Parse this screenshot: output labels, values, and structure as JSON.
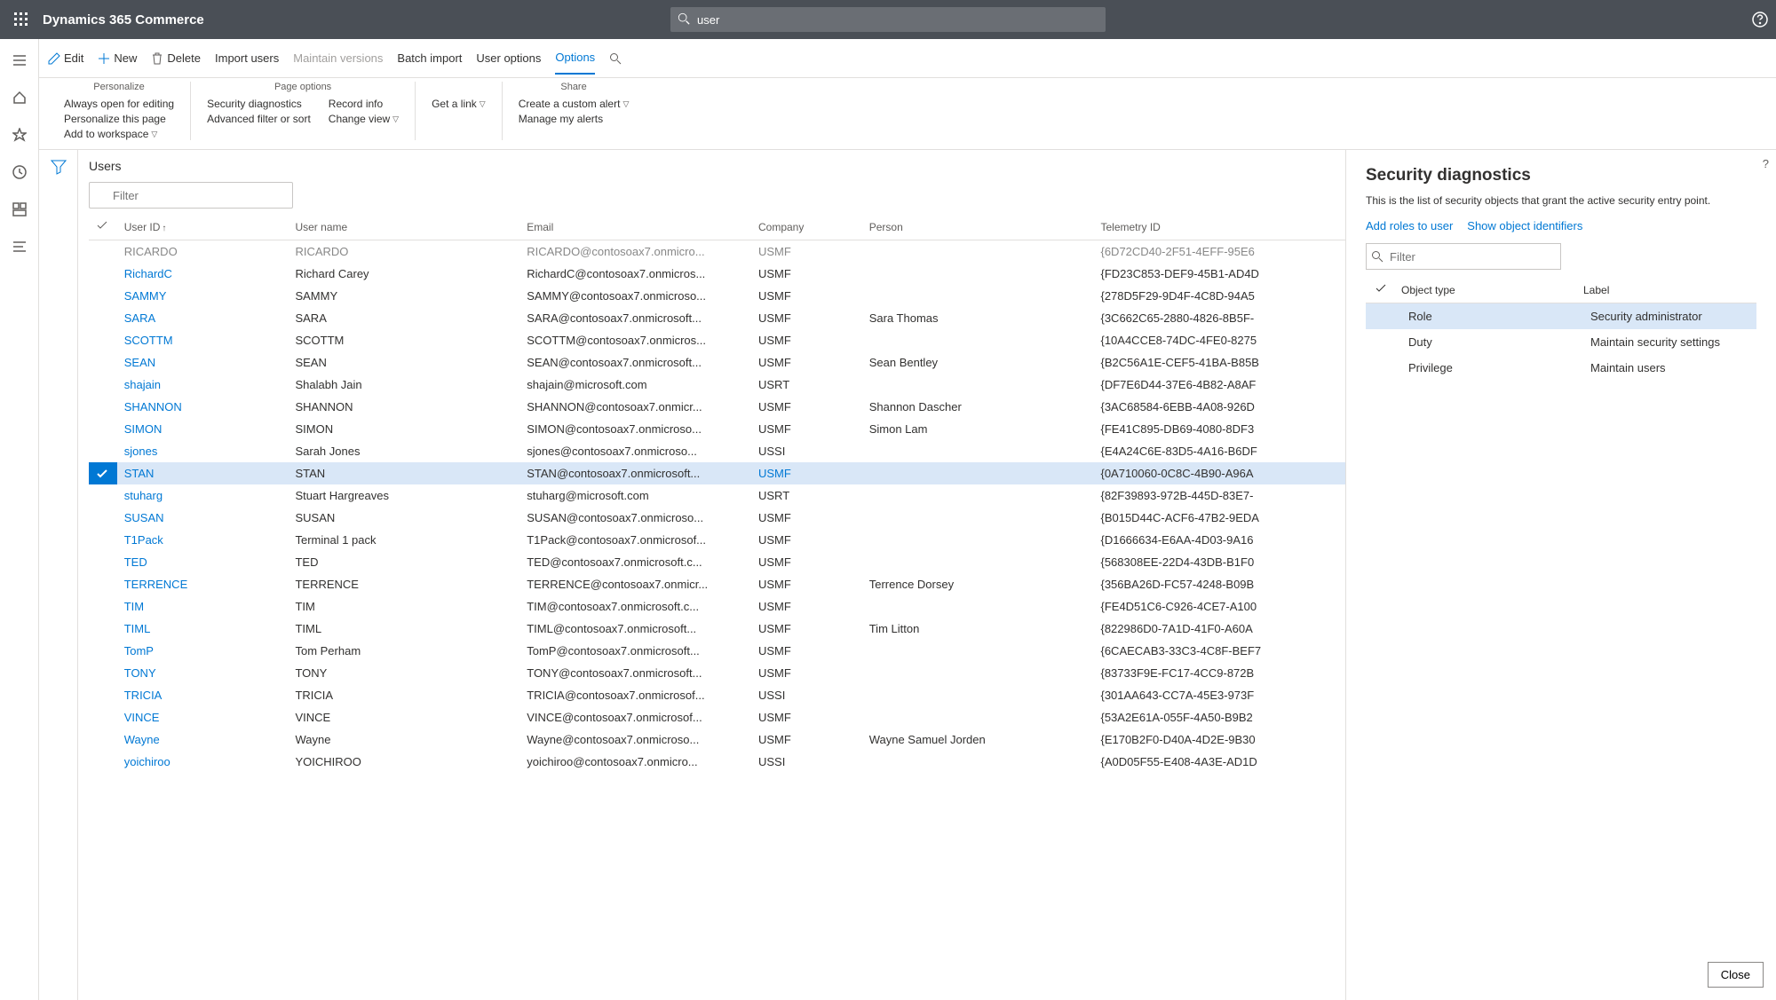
{
  "app": {
    "title": "Dynamics 365 Commerce"
  },
  "search": {
    "value": "user"
  },
  "actions": {
    "edit": "Edit",
    "new": "New",
    "delete": "Delete",
    "import": "Import users",
    "maintain": "Maintain versions",
    "batch": "Batch import",
    "useropt": "User options",
    "options": "Options"
  },
  "ribbon": {
    "personalize": {
      "title": "Personalize",
      "always_open": "Always open for editing",
      "personalize_page": "Personalize this page",
      "add_workspace": "Add to workspace"
    },
    "page_options": {
      "title": "Page options",
      "sec_diag": "Security diagnostics",
      "adv_filter": "Advanced filter or sort",
      "record_info": "Record info",
      "change_view": "Change view"
    },
    "getlink": "Get a link",
    "share": {
      "title": "Share",
      "create_alert": "Create a custom alert",
      "manage_alerts": "Manage my alerts"
    }
  },
  "grid": {
    "title": "Users",
    "filter_placeholder": "Filter",
    "columns": {
      "userid": "User ID",
      "username": "User name",
      "email": "Email",
      "company": "Company",
      "person": "Person",
      "telemetry": "Telemetry ID"
    },
    "rows": [
      {
        "cutoff": true,
        "uid": "RICARDO",
        "uname": "RICARDO",
        "email": "RICARDO@contosoax7.onmicro...",
        "comp": "USMF",
        "person": "",
        "tel": "{6D72CD40-2F51-4EFF-95E6"
      },
      {
        "uid": "RichardC",
        "uname": "Richard Carey",
        "email": "RichardC@contosoax7.onmicros...",
        "comp": "USMF",
        "person": "",
        "tel": "{FD23C853-DEF9-45B1-AD4D"
      },
      {
        "uid": "SAMMY",
        "uname": "SAMMY",
        "email": "SAMMY@contosoax7.onmicroso...",
        "comp": "USMF",
        "person": "",
        "tel": "{278D5F29-9D4F-4C8D-94A5"
      },
      {
        "uid": "SARA",
        "uname": "SARA",
        "email": "SARA@contosoax7.onmicrosoft...",
        "comp": "USMF",
        "person": "Sara Thomas",
        "tel": "{3C662C65-2880-4826-8B5F-"
      },
      {
        "uid": "SCOTTM",
        "uname": "SCOTTM",
        "email": "SCOTTM@contosoax7.onmicros...",
        "comp": "USMF",
        "person": "",
        "tel": "{10A4CCE8-74DC-4FE0-8275"
      },
      {
        "uid": "SEAN",
        "uname": "SEAN",
        "email": "SEAN@contosoax7.onmicrosoft...",
        "comp": "USMF",
        "person": "Sean Bentley",
        "tel": "{B2C56A1E-CEF5-41BA-B85B"
      },
      {
        "uid": "shajain",
        "uname": "Shalabh Jain",
        "email": "shajain@microsoft.com",
        "comp": "USRT",
        "person": "",
        "tel": "{DF7E6D44-37E6-4B82-A8AF"
      },
      {
        "uid": "SHANNON",
        "uname": "SHANNON",
        "email": "SHANNON@contosoax7.onmicr...",
        "comp": "USMF",
        "person": "Shannon Dascher",
        "tel": "{3AC68584-6EBB-4A08-926D"
      },
      {
        "uid": "SIMON",
        "uname": "SIMON",
        "email": "SIMON@contosoax7.onmicroso...",
        "comp": "USMF",
        "person": "Simon Lam",
        "tel": "{FE41C895-DB69-4080-8DF3"
      },
      {
        "uid": "sjones",
        "uname": "Sarah Jones",
        "email": "sjones@contosoax7.onmicroso...",
        "comp": "USSI",
        "person": "",
        "tel": "{E4A24C6E-83D5-4A16-B6DF"
      },
      {
        "selected": true,
        "uid": "STAN",
        "uname": "STAN",
        "email": "STAN@contosoax7.onmicrosoft...",
        "comp": "USMF",
        "person": "",
        "tel": "{0A710060-0C8C-4B90-A96A"
      },
      {
        "uid": "stuharg",
        "uname": "Stuart Hargreaves",
        "email": "stuharg@microsoft.com",
        "comp": "USRT",
        "person": "",
        "tel": "{82F39893-972B-445D-83E7-"
      },
      {
        "uid": "SUSAN",
        "uname": "SUSAN",
        "email": "SUSAN@contosoax7.onmicroso...",
        "comp": "USMF",
        "person": "",
        "tel": "{B015D44C-ACF6-47B2-9EDA"
      },
      {
        "uid": "T1Pack",
        "uname": "Terminal 1 pack",
        "email": "T1Pack@contosoax7.onmicrosof...",
        "comp": "USMF",
        "person": "",
        "tel": "{D1666634-E6AA-4D03-9A16"
      },
      {
        "uid": "TED",
        "uname": "TED",
        "email": "TED@contosoax7.onmicrosoft.c...",
        "comp": "USMF",
        "person": "",
        "tel": "{568308EE-22D4-43DB-B1F0"
      },
      {
        "uid": "TERRENCE",
        "uname": "TERRENCE",
        "email": "TERRENCE@contosoax7.onmicr...",
        "comp": "USMF",
        "person": "Terrence Dorsey",
        "tel": "{356BA26D-FC57-4248-B09B"
      },
      {
        "uid": "TIM",
        "uname": "TIM",
        "email": "TIM@contosoax7.onmicrosoft.c...",
        "comp": "USMF",
        "person": "",
        "tel": "{FE4D51C6-C926-4CE7-A100"
      },
      {
        "uid": "TIML",
        "uname": "TIML",
        "email": "TIML@contosoax7.onmicrosoft...",
        "comp": "USMF",
        "person": "Tim Litton",
        "tel": "{822986D0-7A1D-41F0-A60A"
      },
      {
        "uid": "TomP",
        "uname": "Tom Perham",
        "email": "TomP@contosoax7.onmicrosoft...",
        "comp": "USMF",
        "person": "",
        "tel": "{6CAECAB3-33C3-4C8F-BEF7"
      },
      {
        "uid": "TONY",
        "uname": "TONY",
        "email": "TONY@contosoax7.onmicrosoft...",
        "comp": "USMF",
        "person": "",
        "tel": "{83733F9E-FC17-4CC9-872B"
      },
      {
        "uid": "TRICIA",
        "uname": "TRICIA",
        "email": "TRICIA@contosoax7.onmicrosof...",
        "comp": "USSI",
        "person": "",
        "tel": "{301AA643-CC7A-45E3-973F"
      },
      {
        "uid": "VINCE",
        "uname": "VINCE",
        "email": "VINCE@contosoax7.onmicrosof...",
        "comp": "USMF",
        "person": "",
        "tel": "{53A2E61A-055F-4A50-B9B2"
      },
      {
        "uid": "Wayne",
        "uname": "Wayne",
        "email": "Wayne@contosoax7.onmicroso...",
        "comp": "USMF",
        "person": "Wayne Samuel Jorden",
        "tel": "{E170B2F0-D40A-4D2E-9B30"
      },
      {
        "uid": "yoichiroo",
        "uname": "YOICHIROO",
        "email": "yoichiroo@contosoax7.onmicro...",
        "comp": "USSI",
        "person": "",
        "tel": "{A0D05F55-E408-4A3E-AD1D"
      }
    ]
  },
  "pane": {
    "title": "Security diagnostics",
    "desc": "This is the list of security objects that grant the active security entry point.",
    "add_roles": "Add roles to user",
    "show_ids": "Show object identifiers",
    "filter_placeholder": "Filter",
    "col_type": "Object type",
    "col_label": "Label",
    "rows": [
      {
        "selected": true,
        "type": "Role",
        "label": "Security administrator"
      },
      {
        "type": "Duty",
        "label": "Maintain security settings"
      },
      {
        "type": "Privilege",
        "label": "Maintain users"
      }
    ],
    "close": "Close"
  }
}
